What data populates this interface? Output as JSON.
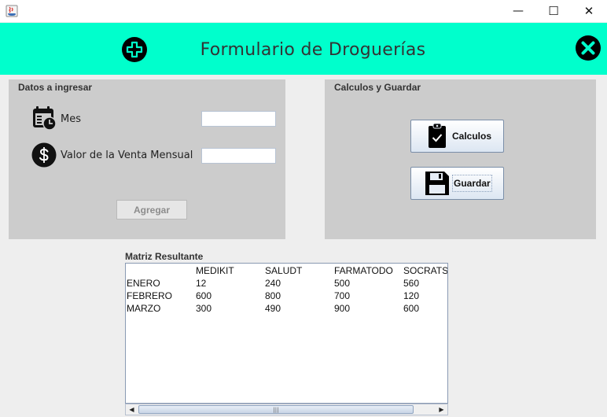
{
  "window": {
    "minimize_label": "—",
    "maximize_label": "☐",
    "close_label": "✕"
  },
  "header": {
    "title": "Formulario de Droguerías",
    "add_icon": "plus-circle-icon",
    "close_icon": "close-circle-icon",
    "background_color": "#00ffcc"
  },
  "datos_panel": {
    "title": "Datos a ingresar",
    "mes": {
      "label": "Mes",
      "value": "",
      "icon": "calendar-clock-icon"
    },
    "valor": {
      "label": "Valor de la Venta Mensual",
      "value": "",
      "icon": "dollar-circle-icon"
    },
    "agregar_label": "Agregar"
  },
  "calc_panel": {
    "title": "Calculos y Guardar",
    "calculos_label": "Calculos",
    "guardar_label": "Guardar"
  },
  "matrix": {
    "title": "Matriz Resultante",
    "headers": [
      "",
      "MEDIKIT",
      "SALUDT",
      "FARMATODO",
      "SOCRATS"
    ],
    "rows": [
      [
        "ENERO",
        "12",
        "240",
        "500",
        "560"
      ],
      [
        "FEBRERO",
        "600",
        "800",
        "700",
        "120"
      ],
      [
        "MARZO",
        "300",
        "490",
        "900",
        "600"
      ]
    ]
  },
  "scrollbar": {
    "grip": "|||"
  }
}
